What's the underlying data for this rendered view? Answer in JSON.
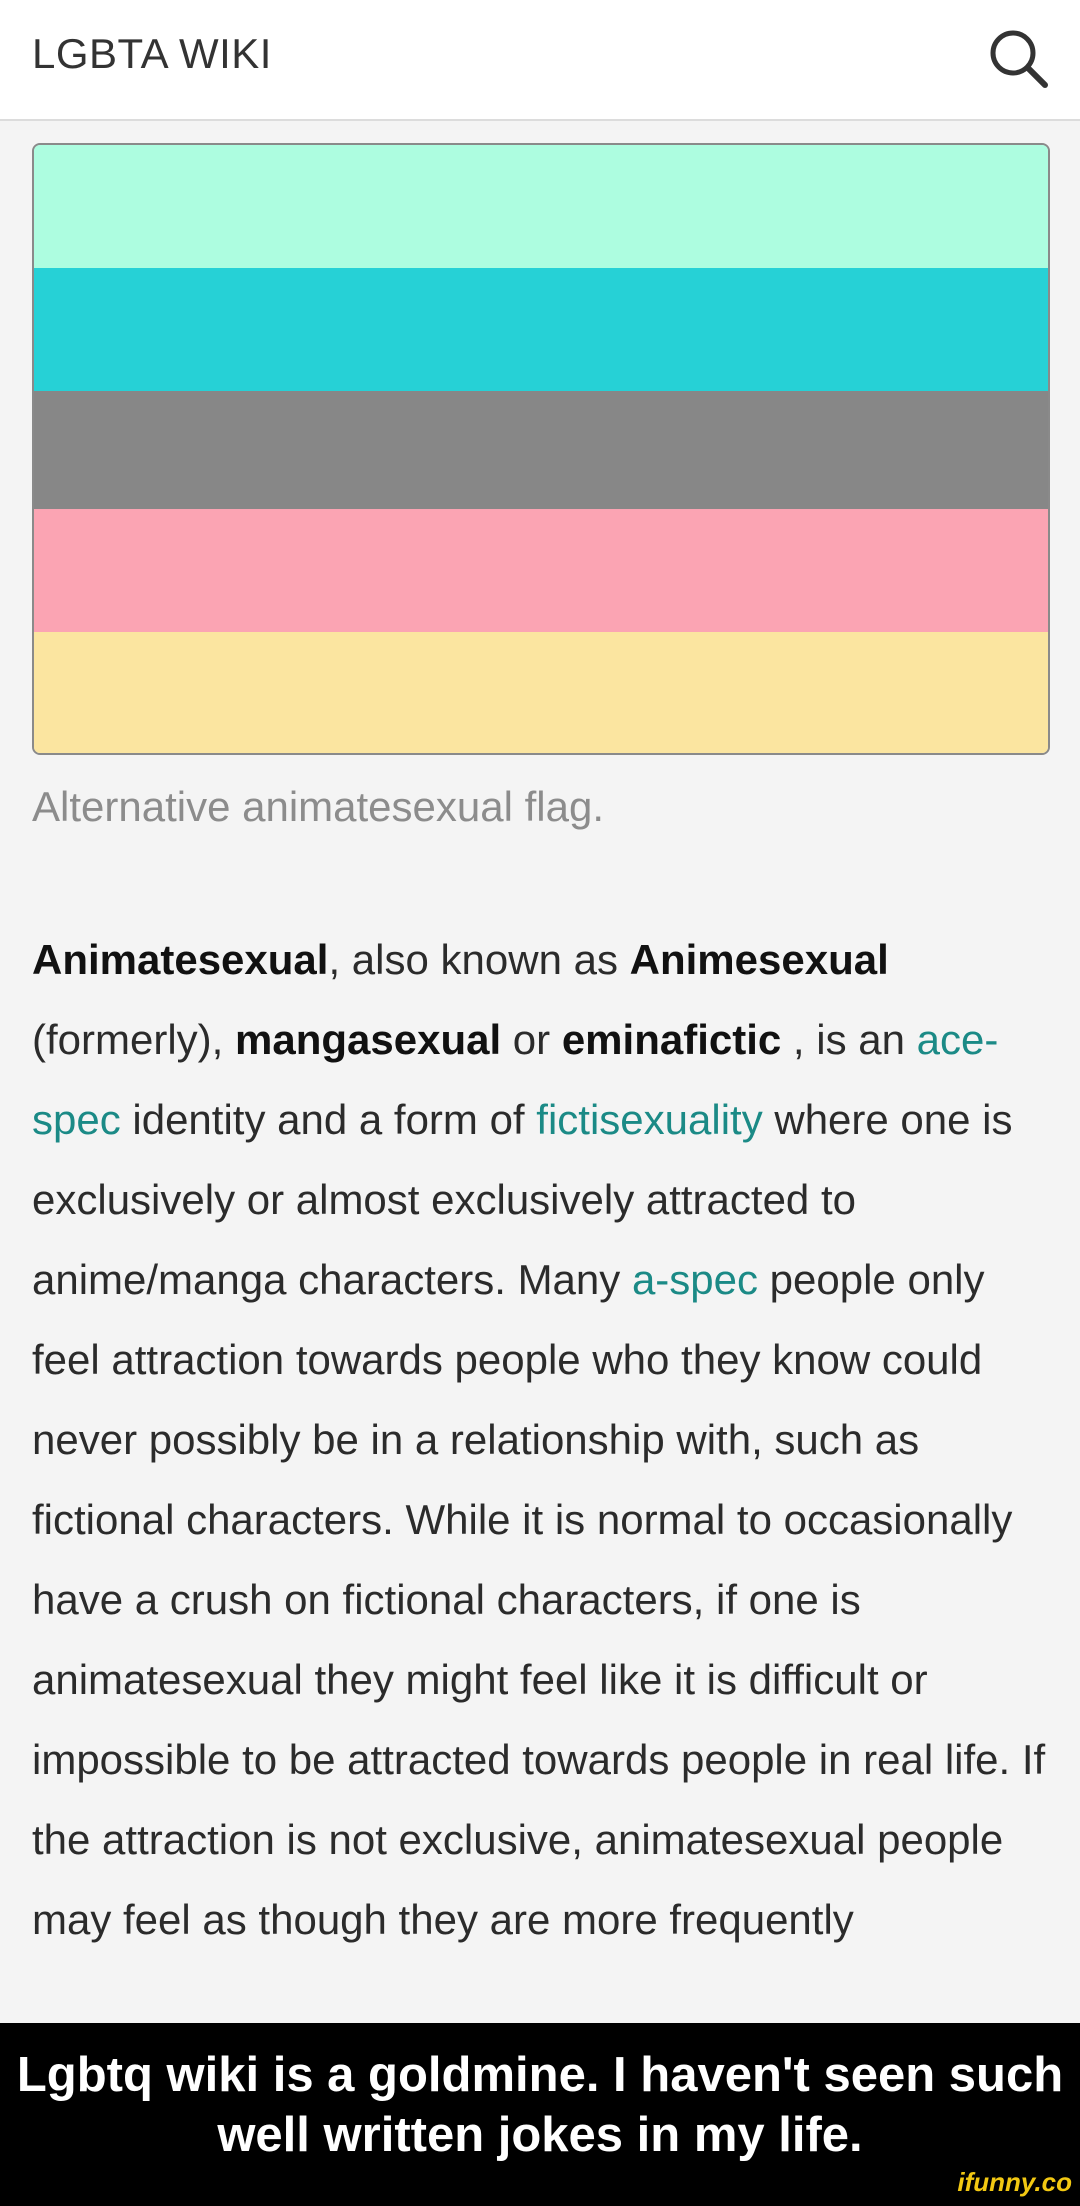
{
  "header": {
    "title": "LGBTA WIKI",
    "search_icon": "search-icon"
  },
  "flag": {
    "stripes": [
      "#adfde0",
      "#26d1d6",
      "#878787",
      "#fba4b3",
      "#fbe5a0"
    ]
  },
  "caption": "Alternative animatesexual flag.",
  "article": {
    "t1": "Animatesexual",
    "t2": ", also known as ",
    "t3": "Animesexual",
    "t4": " (formerly), ",
    "t5": "mangasexual",
    "t6": " or ",
    "t7": "eminafictic",
    "t8": " , is an ",
    "link1": "ace-spec",
    "t9": " identity and a form of ",
    "link2": "fictisexuality",
    "t10": " where one is exclusively or almost exclusively attracted to anime/manga characters. Many ",
    "link3": "a-spec",
    "t11": " people only feel attraction towards people who they know could never possibly be in a relationship with, such as fictional characters. While it is normal to occasionally have a crush on fictional characters, if one is animatesexual they might feel like it is difficult or impossible to be attracted towards people in real life. If the attraction is not exclusive, animatesexual people may feel as though they are more frequently"
  },
  "meme": {
    "caption": "Lgbtq wiki is a goldmine. I haven't seen such well written jokes in my life.",
    "watermark": "ifunny.co"
  },
  "colors": {
    "link": "#1b8a86",
    "meme_background": "#000000",
    "watermark": "#f2c812"
  }
}
